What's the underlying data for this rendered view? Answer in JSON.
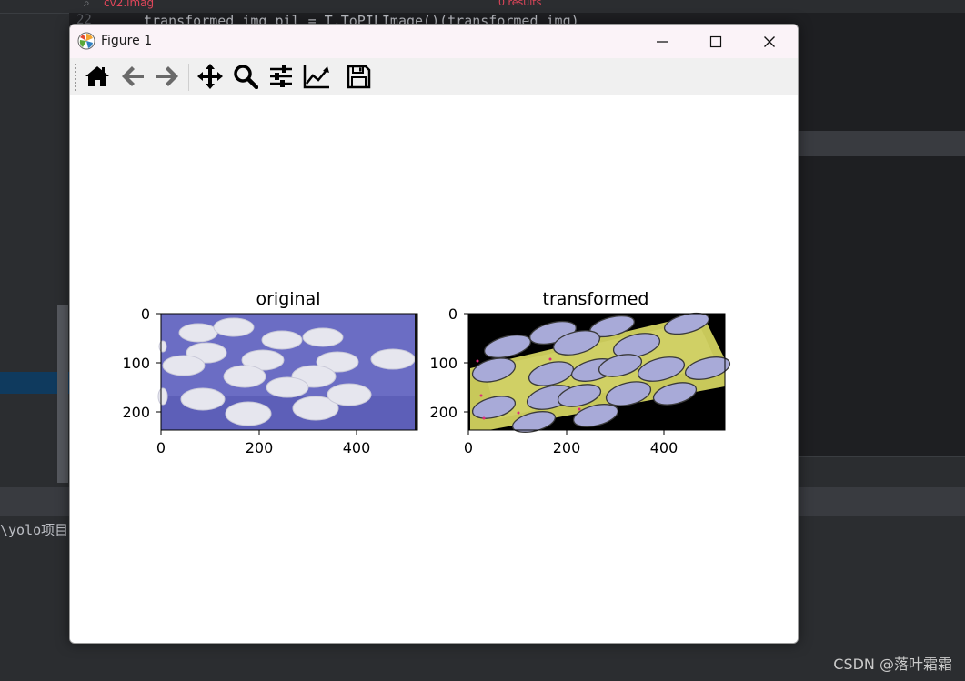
{
  "ide": {
    "code_line_number": "22",
    "code_line": "transformed_img_pil = T.ToPILImage()(transformed_img)",
    "search_text": "cv2.imag",
    "results_text": "0 results",
    "console_text": "\\yolo项目"
  },
  "watermark": "CSDN @落叶霜霜",
  "window": {
    "title": "Figure 1",
    "controls": [
      "minimize",
      "maximize",
      "close"
    ]
  },
  "toolbar": {
    "buttons": [
      {
        "name": "home",
        "icon": "home-icon"
      },
      {
        "name": "back",
        "icon": "arrow-left-icon"
      },
      {
        "name": "forward",
        "icon": "arrow-right-icon"
      },
      {
        "name": "pan",
        "icon": "move-icon"
      },
      {
        "name": "zoom",
        "icon": "magnifier-icon"
      },
      {
        "name": "configure-subplots",
        "icon": "sliders-icon"
      },
      {
        "name": "edit-axes",
        "icon": "line-chart-icon"
      },
      {
        "name": "save",
        "icon": "floppy-disk-icon"
      }
    ]
  },
  "figure": {
    "subplots": [
      {
        "title": "original",
        "xticks": [
          "0",
          "200",
          "400"
        ],
        "yticks": [
          "0",
          "100",
          "200"
        ],
        "image_colors": {
          "background": "#6b6dc4",
          "pill": "#e6e6ee"
        }
      },
      {
        "title": "transformed",
        "xticks": [
          "0",
          "200",
          "400"
        ],
        "yticks": [
          "0",
          "100",
          "200"
        ],
        "image_colors": {
          "background": "#000000",
          "surface": "#c8c85a",
          "pill": "#a8aad8"
        }
      }
    ]
  }
}
